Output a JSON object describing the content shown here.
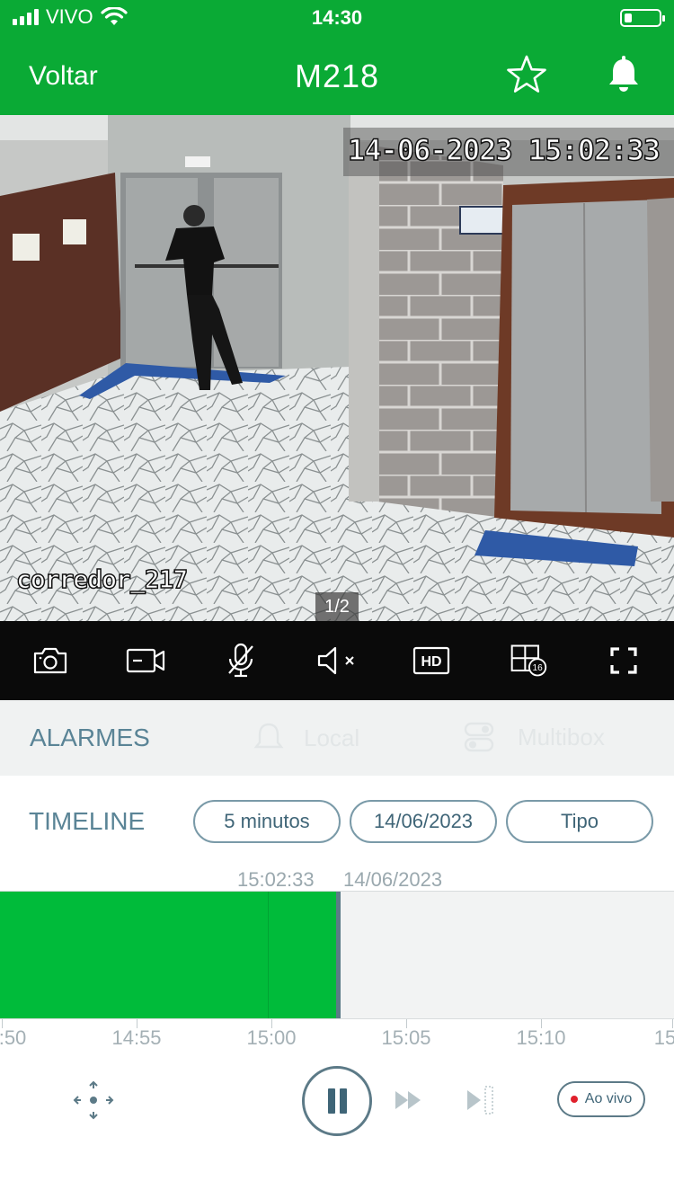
{
  "status_bar": {
    "carrier": "VIVO",
    "time": "14:30"
  },
  "nav": {
    "back_label": "Voltar",
    "title": "M218",
    "star_icon": "star-icon",
    "bell_icon": "bell-icon"
  },
  "camera": {
    "osd_datetime": "14-06-2023 15:02:33",
    "osd_name": "corredor_217",
    "page_indicator": "1/2"
  },
  "toolbar": {
    "icons": [
      "camera-icon",
      "video-record-icon",
      "mic-off-icon",
      "speaker-mute-icon",
      "hd-icon",
      "grid-16-icon",
      "fullscreen-icon"
    ],
    "hd_label": "HD",
    "grid_badge": "16"
  },
  "tabs": {
    "alarmes": "ALARMES",
    "local": "Local",
    "multibox": "Multibox"
  },
  "timeline": {
    "label": "TIMELINE",
    "interval": "5 minutos",
    "date": "14/06/2023",
    "type": "Tipo",
    "cursor_time": "15:02:33",
    "cursor_date": "14/06/2023",
    "ticks": [
      ":50",
      "14:55",
      "15:00",
      "15:05",
      "15:10",
      "15"
    ]
  },
  "controls": {
    "live_label": "Ao vivo"
  },
  "colors": {
    "brand_green": "#0aaa35",
    "recorded_green": "#00bb3a",
    "accent_slate": "#5c7a87"
  }
}
